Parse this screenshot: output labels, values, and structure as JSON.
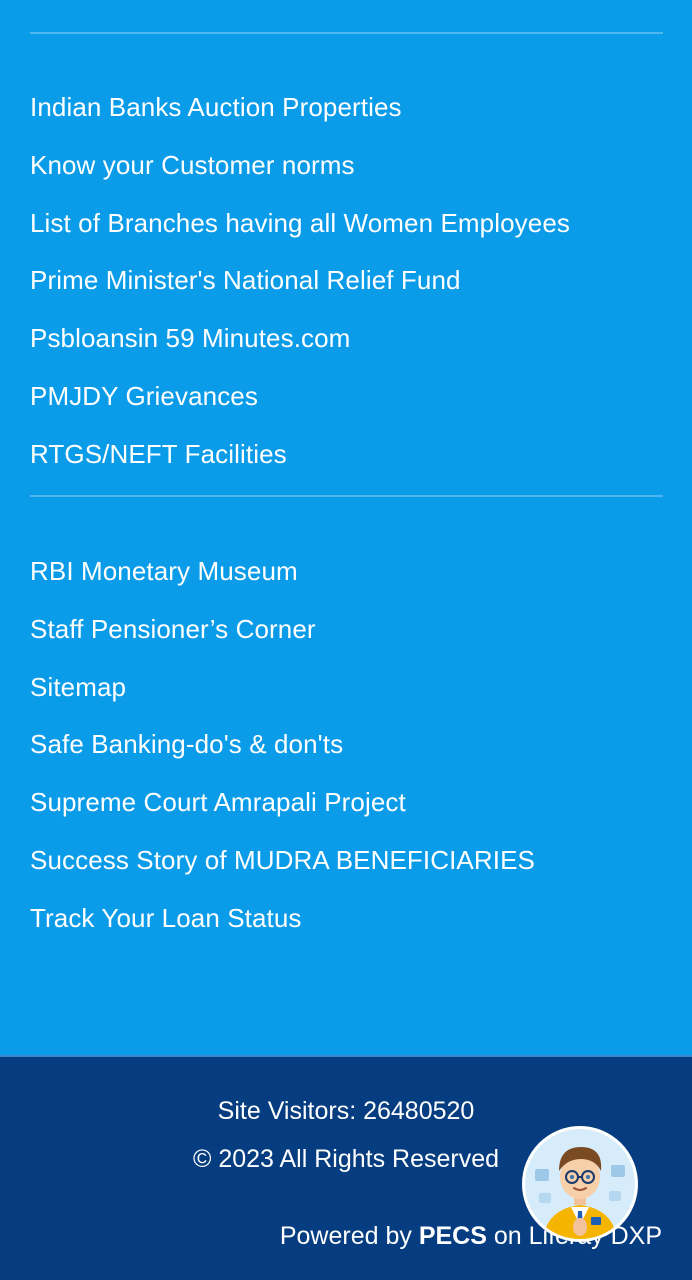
{
  "links_group_1": [
    "Indian Banks Auction Properties",
    "Know your Customer norms",
    "List of Branches having all Women Employees",
    "Prime Minister's National Relief Fund",
    "Psbloansin 59 Minutes.com",
    "PMJDY Grievances",
    "RTGS/NEFT Facilities"
  ],
  "links_group_2": [
    "RBI Monetary Museum",
    "Staff Pensioner’s Corner",
    "Sitemap",
    "Safe Banking-do's & don'ts",
    "Supreme Court Amrapali Project",
    "Success Story of MUDRA BENEFICIARIES",
    "Track Your Loan Status"
  ],
  "footer": {
    "visitors_label": "Site Visitors: 26480520",
    "copyright": "© 2023 All Rights Reserved",
    "powered_prefix": "Powered by ",
    "powered_brand": "PECS",
    "powered_suffix": " on Liferay DXP"
  },
  "assistant": {
    "icon": "chat-assistant-avatar-icon"
  },
  "colors": {
    "links_bg": "#0a9be9",
    "footer_bg": "#053d80",
    "text": "#ffffff"
  }
}
